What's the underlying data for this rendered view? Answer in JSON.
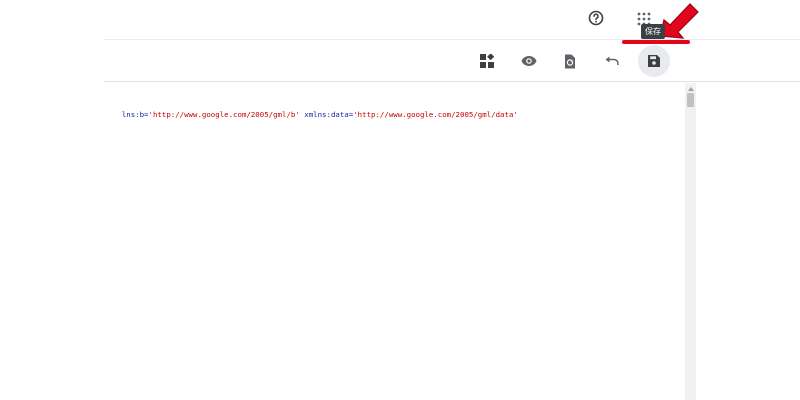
{
  "header": {
    "help_icon": "help-circle-icon",
    "apps_icon": "apps-grid-icon"
  },
  "toolbar": {
    "buttons": [
      {
        "icon": "layout-widgets-icon"
      },
      {
        "icon": "preview-eye-icon"
      },
      {
        "icon": "revert-document-icon"
      },
      {
        "icon": "undo-icon"
      },
      {
        "icon": "save-floppy-icon"
      }
    ],
    "save_tooltip": "保存"
  },
  "annotation": {
    "color": "#e1061a"
  },
  "editor": {
    "tokens": [
      {
        "text": "lns:b=",
        "kind": "attr"
      },
      {
        "text": "'http://www.google.com/2005/gml/b'",
        "kind": "str"
      },
      {
        "text": " xmlns:data=",
        "kind": "attr"
      },
      {
        "text": "'http://www.google.com/2005/gml/data'",
        "kind": "str"
      }
    ]
  },
  "colors": {
    "attr": "#1a1aa6",
    "string": "#c80000",
    "icon": "#5f6368"
  }
}
